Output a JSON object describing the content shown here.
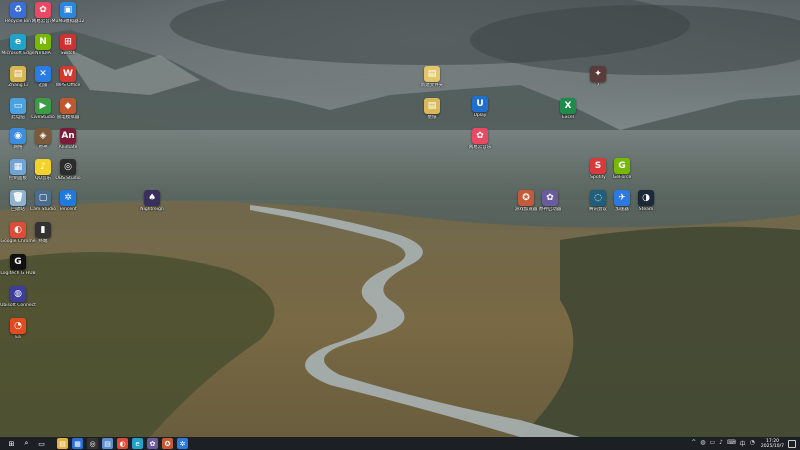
{
  "desktop": {
    "icons": [
      {
        "name": "icon-1",
        "label": "Recycle Bin",
        "color": "#3a6fd8",
        "glyph": "♻"
      },
      {
        "name": "icon-2",
        "label": "网易云音乐",
        "color": "#e84a63",
        "glyph": "✿"
      },
      {
        "name": "icon-3",
        "label": "MuMu模拟器12",
        "color": "#2b86e0",
        "glyph": "▣"
      },
      {
        "name": "icon-4",
        "label": "Microsoft Edge",
        "color": "#1fa3c9",
        "glyph": "e"
      },
      {
        "name": "icon-5",
        "label": "NVIDIA",
        "color": "#76b900",
        "glyph": "N"
      },
      {
        "name": "icon-6",
        "label": "Switch",
        "color": "#d03030",
        "glyph": "⊞"
      },
      {
        "name": "icon-7",
        "label": "Zhang Li",
        "color": "#d9b650",
        "glyph": "▤"
      },
      {
        "name": "icon-8",
        "label": "迅雷",
        "color": "#2a7be4",
        "glyph": "✕"
      },
      {
        "name": "icon-9",
        "label": "WPS Office",
        "color": "#d33a2f",
        "glyph": "W"
      },
      {
        "name": "icon-10",
        "label": "此电脑",
        "color": "#4aa3e0",
        "glyph": "▭"
      },
      {
        "name": "icon-11",
        "label": "LiveStudio",
        "color": "#3c9b45",
        "glyph": "▶"
      },
      {
        "name": "icon-12",
        "label": "雷电模拟器",
        "color": "#c0582f",
        "glyph": "◆"
      },
      {
        "name": "icon-13",
        "label": "网络",
        "color": "#3b8de0",
        "glyph": "◉"
      },
      {
        "name": "icon-14",
        "label": "原神",
        "color": "#7a5a3a",
        "glyph": "◈"
      },
      {
        "name": "icon-15",
        "label": "Animate",
        "color": "#7b1b3a",
        "glyph": "An"
      },
      {
        "name": "icon-16",
        "label": "控制面板",
        "color": "#6fa4d6",
        "glyph": "▦"
      },
      {
        "name": "icon-17",
        "label": "QQ音乐",
        "color": "#f5d22a",
        "glyph": "♪"
      },
      {
        "name": "icon-18",
        "label": "OBS Studio",
        "color": "#2c2c2c",
        "glyph": "◎"
      },
      {
        "name": "icon-19",
        "label": "回收站",
        "color": "#8fb3cf",
        "glyph": "🗑"
      },
      {
        "name": "icon-20",
        "label": "Cam Studio",
        "color": "#4b6c8c",
        "glyph": "▢"
      },
      {
        "name": "icon-21",
        "label": "Tencent",
        "color": "#1e7ae0",
        "glyph": "✲"
      },
      {
        "name": "icon-22",
        "label": "Google Chrome",
        "color": "#dd4b39",
        "glyph": "◐"
      },
      {
        "name": "icon-23",
        "label": "终端",
        "color": "#333333",
        "glyph": "▮"
      },
      {
        "name": "icon-24",
        "label": "Logitech G HUB",
        "color": "#111111",
        "glyph": "G"
      },
      {
        "name": "icon-25",
        "label": "Ubisoft Connect",
        "color": "#3d3d9e",
        "glyph": "◍"
      },
      {
        "name": "icon-26",
        "label": "Ea",
        "color": "#e34b1e",
        "glyph": "◔"
      },
      {
        "name": "icon-27",
        "label": "Nightreign",
        "color": "#3a2e5a",
        "glyph": "♠"
      },
      {
        "name": "icon-28",
        "label": "新建文件夹",
        "color": "#e3c56a",
        "glyph": "▤"
      },
      {
        "name": "icon-29",
        "label": "壁纸",
        "color": "#d8b85a",
        "glyph": "▤"
      },
      {
        "name": "icon-30",
        "label": "Uplay",
        "color": "#1f6fd0",
        "glyph": "U"
      },
      {
        "name": "icon-31",
        "label": "网易云音乐",
        "color": "#e84a63",
        "glyph": "✿"
      },
      {
        "name": "icon-32",
        "label": "Excel",
        "color": "#1f8b4c",
        "glyph": "X"
      },
      {
        "name": "icon-33",
        "label": "7",
        "color": "#5a3a3a",
        "glyph": "✦"
      },
      {
        "name": "icon-34",
        "label": "Spotify",
        "color": "#d83a3a",
        "glyph": "S"
      },
      {
        "name": "icon-35",
        "label": "GeForce",
        "color": "#76b900",
        "glyph": "G"
      },
      {
        "name": "icon-36",
        "label": "游戏加速器",
        "color": "#c45a3a",
        "glyph": "✪"
      },
      {
        "name": "icon-37",
        "label": "原神启动器",
        "color": "#6a5aa0",
        "glyph": "✿"
      },
      {
        "name": "icon-38",
        "label": "腾讯会议",
        "color": "#1f5f7a",
        "glyph": "◌"
      },
      {
        "name": "icon-39",
        "label": "加速器",
        "color": "#2a7ae0",
        "glyph": "✈"
      },
      {
        "name": "icon-40",
        "label": "Steam",
        "color": "#1b2838",
        "glyph": "◑"
      }
    ]
  },
  "taskbar": {
    "start": "⊞",
    "search": "⌕",
    "taskview": "▭",
    "pinned": [
      {
        "name": "taskbar-explorer",
        "color": "#e3b341",
        "glyph": "▤"
      },
      {
        "name": "taskbar-store",
        "color": "#2a6fd8",
        "glyph": "▦"
      },
      {
        "name": "taskbar-obs",
        "color": "#333333",
        "glyph": "◎"
      },
      {
        "name": "taskbar-files",
        "color": "#5a8fd0",
        "glyph": "▤"
      },
      {
        "name": "taskbar-chrome",
        "color": "#dd4b39",
        "glyph": "◐"
      },
      {
        "name": "taskbar-edge",
        "color": "#1fa3c9",
        "glyph": "e"
      },
      {
        "name": "taskbar-app1",
        "color": "#6a5aa0",
        "glyph": "✿"
      },
      {
        "name": "taskbar-app2",
        "color": "#c45a3a",
        "glyph": "✪"
      },
      {
        "name": "taskbar-app3",
        "color": "#2a7ae0",
        "glyph": "✲"
      }
    ],
    "tray": [
      "^",
      "◍",
      "▭",
      "♪",
      "⌨",
      "中",
      "◔"
    ],
    "time": "17:20",
    "date": "2025/10/7"
  }
}
